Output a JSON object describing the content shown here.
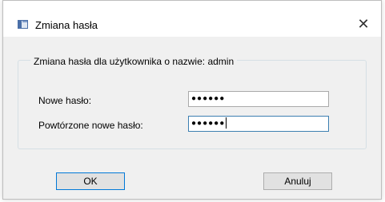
{
  "window": {
    "title": "Zmiana hasła",
    "close_glyph": "✕"
  },
  "group": {
    "legend": "Zmiana hasła dla użytkownika o nazwie: admin"
  },
  "fields": {
    "new_password": {
      "label": "Nowe hasło:",
      "value": "●●●●●●"
    },
    "repeat_password": {
      "label": "Powtórzone nowe hasło:",
      "value": "●●●●●●"
    }
  },
  "buttons": {
    "ok": "OK",
    "cancel": "Anuluj"
  }
}
